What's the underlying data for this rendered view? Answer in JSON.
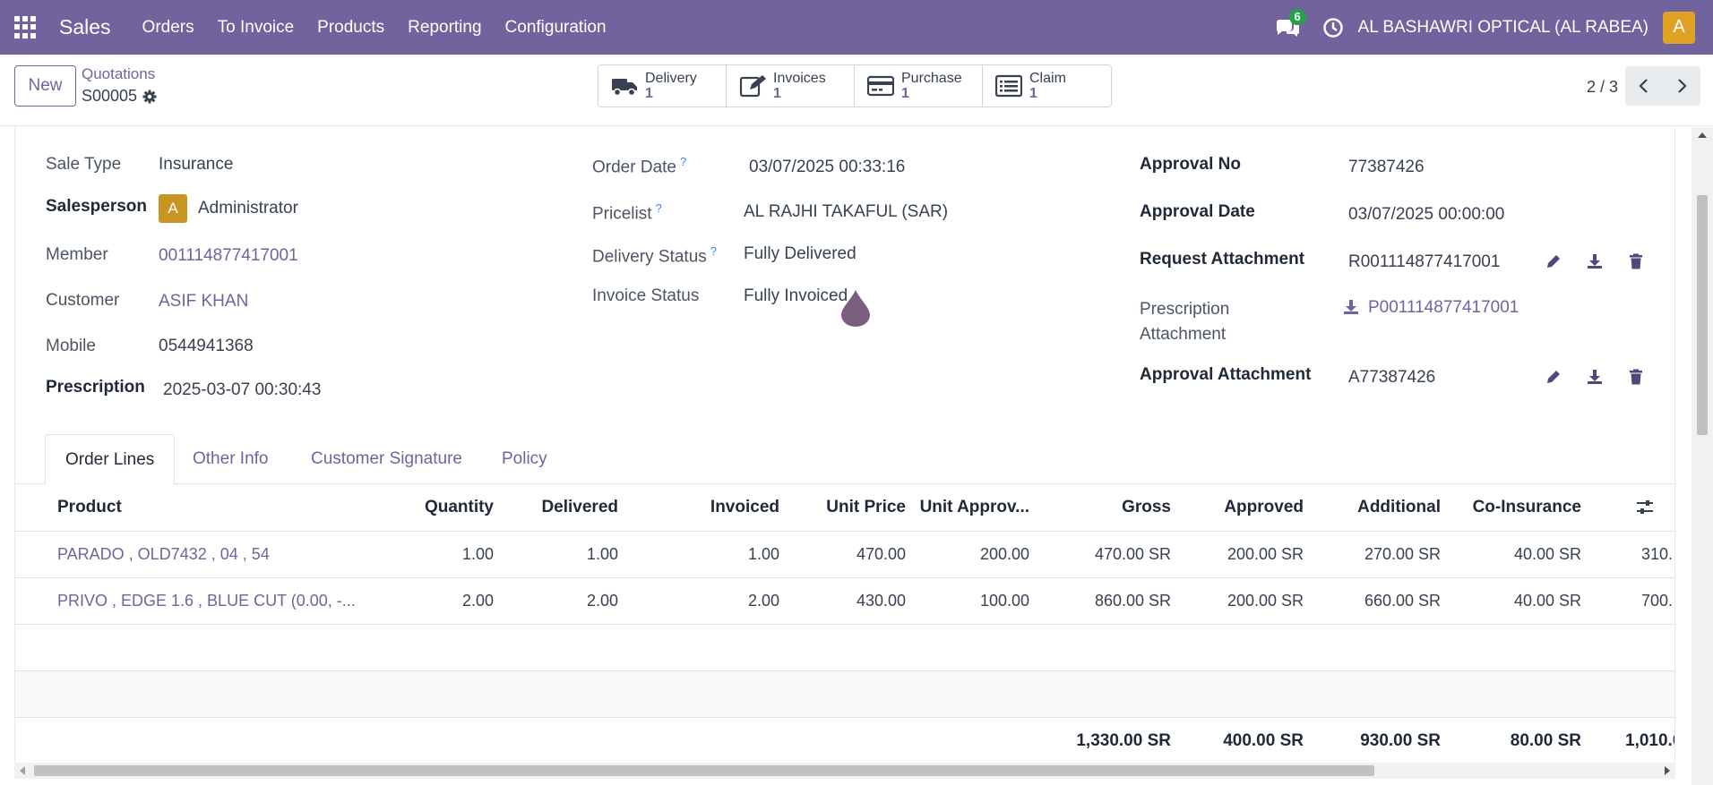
{
  "navbar": {
    "app_name": "Sales",
    "menu": [
      "Orders",
      "To Invoice",
      "Products",
      "Reporting",
      "Configuration"
    ],
    "chat_count": "6",
    "company": "AL BASHAWRI OPTICAL (AL RABEA)",
    "user_initial": "A",
    "color": "#71639e"
  },
  "control": {
    "new_label": "New",
    "breadcrumb_parent": "Quotations",
    "breadcrumb_current": "S00005",
    "pager": "2 / 3",
    "smart_buttons": [
      {
        "label": "Delivery",
        "count": "1",
        "icon": "truck-icon"
      },
      {
        "label": "Invoices",
        "count": "1",
        "icon": "edit-icon"
      },
      {
        "label": "Purchase",
        "count": "1",
        "icon": "credit-card-icon"
      },
      {
        "label": "Claim",
        "count": "1",
        "icon": "list-icon"
      }
    ]
  },
  "form": {
    "left": {
      "sale_type_label": "Sale Type",
      "sale_type": "Insurance",
      "salesperson_label": "Salesperson",
      "salesperson_initial": "A",
      "salesperson": "Administrator",
      "member_label": "Member",
      "member": "001114877417001",
      "customer_label": "Customer",
      "customer": "ASIF KHAN",
      "mobile_label": "Mobile",
      "mobile": "0544941368",
      "prescription_label": "Prescription",
      "prescription": "2025-03-07 00:30:43"
    },
    "middle": {
      "order_date_label": "Order Date",
      "order_date": "03/07/2025 00:33:16",
      "pricelist_label": "Pricelist",
      "pricelist": "AL RAJHI TAKAFUL (SAR)",
      "delivery_status_label": "Delivery Status",
      "delivery_status": "Fully Delivered",
      "invoice_status_label": "Invoice Status",
      "invoice_status": "Fully Invoiced",
      "help_mark": "?"
    },
    "right": {
      "approval_no_label": "Approval No",
      "approval_no": "77387426",
      "approval_date_label": "Approval Date",
      "approval_date": "03/07/2025 00:00:00",
      "request_attachment_label": "Request Attachment",
      "request_attachment": "R001114877417001",
      "prescription_attachment_label_1": "Prescription",
      "prescription_attachment_label_2": "Attachment",
      "prescription_attachment": "P001114877417001",
      "approval_attachment_label": "Approval Attachment",
      "approval_attachment": "A77387426"
    }
  },
  "tabs": [
    "Order Lines",
    "Other Info",
    "Customer Signature",
    "Policy"
  ],
  "table": {
    "headers": [
      "Product",
      "Quantity",
      "Delivered",
      "Invoiced",
      "Unit Price",
      "Unit Approv...",
      "Gross",
      "Approved",
      "Additional",
      "Co-Insurance"
    ],
    "rows": [
      [
        "PARADO , OLD7432 , 04 , 54",
        "1.00",
        "1.00",
        "1.00",
        "470.00",
        "200.00",
        "470.00 SR",
        "200.00 SR",
        "270.00 SR",
        "40.00 SR",
        "310."
      ],
      [
        "PRIVO , EDGE 1.6 , BLUE CUT (0.00, -...",
        "2.00",
        "2.00",
        "2.00",
        "430.00",
        "100.00",
        "860.00 SR",
        "200.00 SR",
        "660.00 SR",
        "40.00 SR",
        "700."
      ]
    ],
    "totals": [
      "1,330.00 SR",
      "400.00 SR",
      "930.00 SR",
      "80.00 SR",
      "1,010.0"
    ]
  }
}
